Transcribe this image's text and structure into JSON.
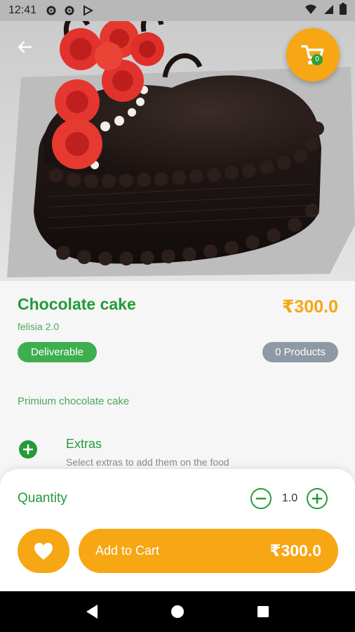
{
  "status_bar": {
    "time": "12:41",
    "left_icons": [
      "gear-icon",
      "gear-icon",
      "play-protect-icon"
    ],
    "right_icons": [
      "wifi-icon",
      "signal-icon",
      "battery-icon"
    ]
  },
  "header": {
    "back_icon": "arrow-left-icon",
    "cart": {
      "icon": "cart-icon",
      "count": "0"
    }
  },
  "product": {
    "name": "Chocolate cake",
    "price": "₹300.0",
    "shop": "felisia 2.0",
    "delivery_badge": "Deliverable",
    "products_badge": "0 Products",
    "description": "Primium chocolate cake"
  },
  "extras": {
    "title": "Extras",
    "subtitle": "Select extras to add them on the food"
  },
  "quantity": {
    "label": "Quantity",
    "value": "1.0"
  },
  "actions": {
    "favorite_icon": "heart-icon",
    "add_to_cart_label": "Add to Cart",
    "total": "₹300.0"
  },
  "colors": {
    "primary_green": "#249a39",
    "accent_orange": "#f7a614",
    "badge_gray": "#8e99a5"
  }
}
